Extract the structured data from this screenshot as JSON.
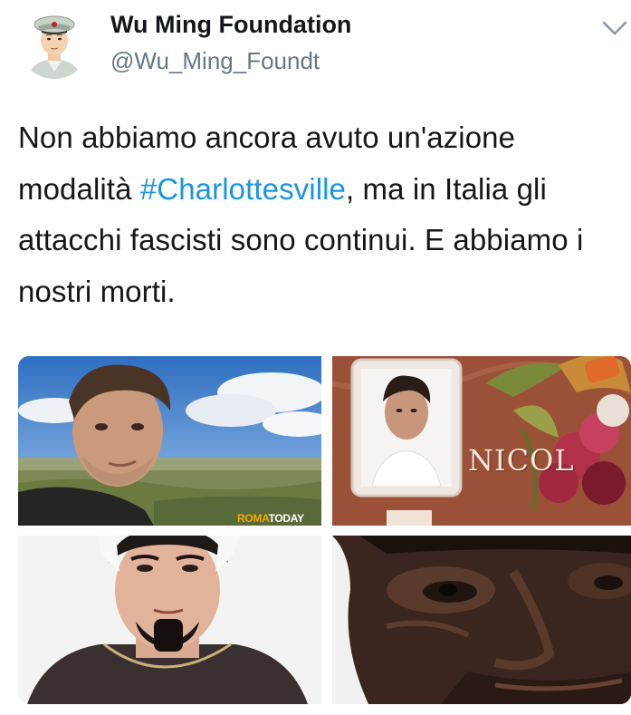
{
  "author": {
    "display_name": "Wu Ming Foundation",
    "handle": "@Wu_Ming_Foundt",
    "avatar_icon": "cartoon-officer-avatar-icon"
  },
  "menu": {
    "icon": "chevron-down-icon"
  },
  "tweet": {
    "text_before": "Non abbiamo ancora avuto un'azione modalità ",
    "hashtag": "#Charlottesville",
    "text_after": ", ma in Italia gli attacchi fascisti sono continui. E abbiamo i nostri morti.",
    "link_color": "#1b95e0"
  },
  "media": {
    "tile1": {
      "watermark_part1": "ROMA",
      "watermark_part2": "TODAY"
    },
    "tile2": {
      "plaque_text": "NICOL"
    }
  },
  "colors": {
    "name": "#14171a",
    "handle": "#657786",
    "hashtag": "#1b95e0"
  }
}
